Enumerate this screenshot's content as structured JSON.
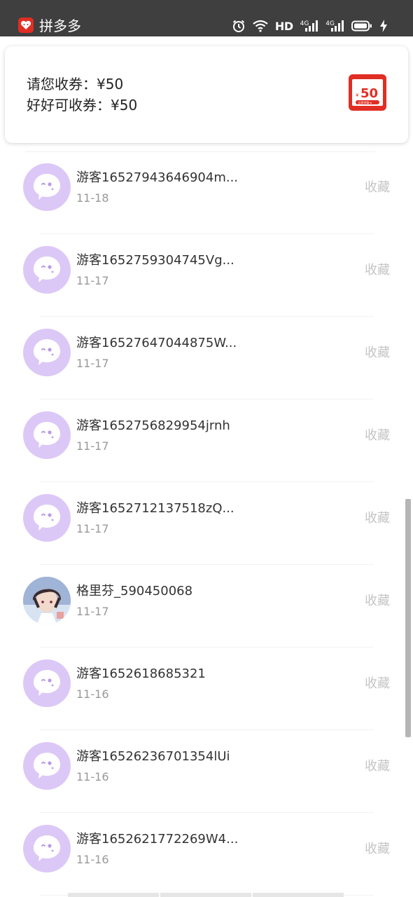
{
  "status_bar": {
    "app_name": "拼多多",
    "hd_label": "HD",
    "network_1": "4G",
    "network_2": "4G",
    "icons": [
      "app-logo-icon",
      "alarm-icon",
      "wifi-icon",
      "signal-icon",
      "signal-icon",
      "battery-icon",
      "charging-icon"
    ]
  },
  "coupon": {
    "line1": "请您收券：¥50",
    "line2": "好好可收券：¥50",
    "ticket_amount": "50",
    "ticket_currency": "¥",
    "ticket_button": "立即领取 ▸"
  },
  "messages": [
    {
      "name": "游客16527943646904m...",
      "date": "11-18",
      "action": "收藏",
      "avatar": "default"
    },
    {
      "name": "游客1652759304745Vg...",
      "date": "11-17",
      "action": "收藏",
      "avatar": "default"
    },
    {
      "name": "游客16527647044875W...",
      "date": "11-17",
      "action": "收藏",
      "avatar": "default"
    },
    {
      "name": "游客1652756829954jrnh",
      "date": "11-17",
      "action": "收藏",
      "avatar": "default"
    },
    {
      "name": "游客1652712137518zQ...",
      "date": "11-17",
      "action": "收藏",
      "avatar": "default"
    },
    {
      "name": "格里芬_590450068",
      "date": "11-17",
      "action": "收藏",
      "avatar": "photo"
    },
    {
      "name": "游客1652618685321",
      "date": "11-16",
      "action": "收藏",
      "avatar": "default"
    },
    {
      "name": "游客16526236701354lUi",
      "date": "11-16",
      "action": "收藏",
      "avatar": "default"
    },
    {
      "name": "游客1652621772269W4...",
      "date": "11-16",
      "action": "收藏",
      "avatar": "default"
    }
  ],
  "colors": {
    "status_bar_bg": "#3f3f3f",
    "brand_red": "#e02e24",
    "avatar_bg": "#dcc8f7",
    "avatar_accent": "#b99be6",
    "muted_text": "#999999",
    "action_text": "#c4c4c4"
  }
}
